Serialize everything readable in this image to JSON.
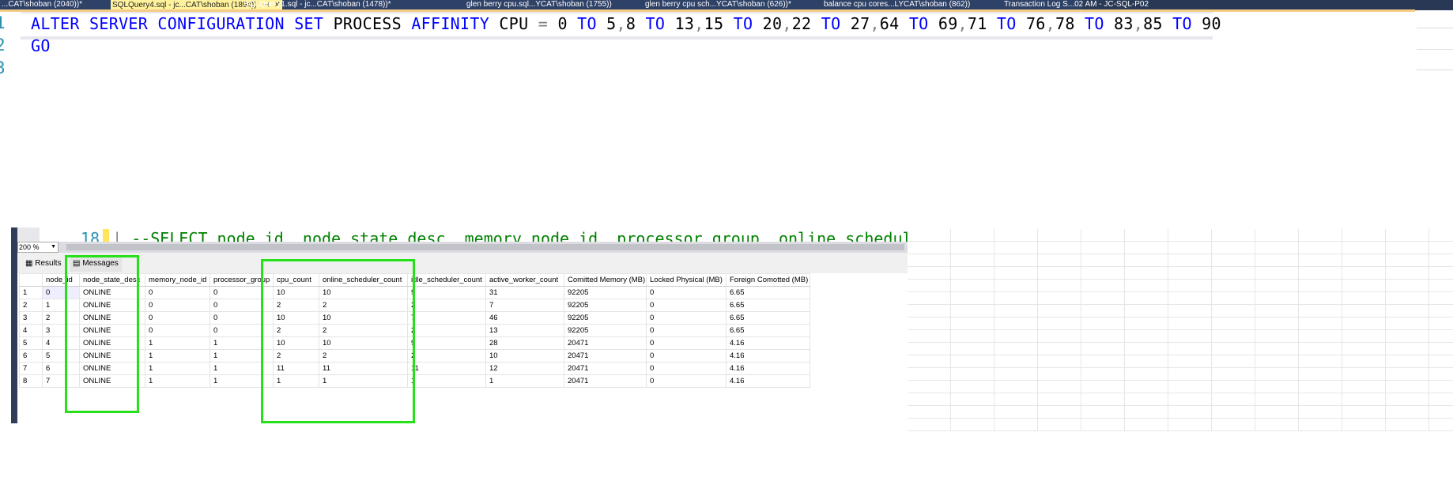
{
  "tabs": [
    {
      "label": "...CAT\\shoban (2040))*",
      "active": false
    },
    {
      "label": "SQLQuery4.sql - jc...CAT\\shoban (1894))",
      "active": true
    },
    {
      "label": "SQLQuery1.sql - jc...CAT\\shoban (1478))*",
      "active": false
    },
    {
      "label": "glen berry cpu.sql...YCAT\\shoban (1755))",
      "active": false
    },
    {
      "label": "glen berry cpu sch...YCAT\\shoban (626))*",
      "active": false
    },
    {
      "label": "balance cpu cores...LYCAT\\shoban (862))",
      "active": false
    },
    {
      "label": "Transaction Log S...02 AM - JC-SQL-P02",
      "active": false
    }
  ],
  "tab_icons": {
    "pin": "⊣",
    "close": "✕"
  },
  "editor": {
    "line_numbers": [
      "1",
      "2",
      "3"
    ],
    "line1_tokens": [
      {
        "t": "ALTER SERVER CONFIGURATION SET",
        "c": "kw"
      },
      {
        "t": " PROCESS ",
        "c": ""
      },
      {
        "t": "AFFINITY",
        "c": "kw"
      },
      {
        "t": " CPU ",
        "c": ""
      },
      {
        "t": "=",
        "c": "op"
      },
      {
        "t": " 0 ",
        "c": ""
      },
      {
        "t": "TO",
        "c": "kw"
      },
      {
        "t": " 5",
        "c": ""
      },
      {
        "t": ",",
        "c": "op"
      },
      {
        "t": "8 ",
        "c": ""
      },
      {
        "t": "TO",
        "c": "kw"
      },
      {
        "t": " 13",
        "c": ""
      },
      {
        "t": ",",
        "c": "op"
      },
      {
        "t": "15 ",
        "c": ""
      },
      {
        "t": "TO",
        "c": "kw"
      },
      {
        "t": " 20",
        "c": ""
      },
      {
        "t": ",",
        "c": "op"
      },
      {
        "t": "22 ",
        "c": ""
      },
      {
        "t": "TO",
        "c": "kw"
      },
      {
        "t": " 27",
        "c": ""
      },
      {
        "t": ",",
        "c": "op"
      },
      {
        "t": "64 ",
        "c": ""
      },
      {
        "t": "TO",
        "c": "kw"
      },
      {
        "t": " 69",
        "c": ""
      },
      {
        "t": ",",
        "c": "op"
      },
      {
        "t": "71 ",
        "c": ""
      },
      {
        "t": "TO",
        "c": "kw"
      },
      {
        "t": " 76",
        "c": ""
      },
      {
        "t": ",",
        "c": "op"
      },
      {
        "t": "78 ",
        "c": ""
      },
      {
        "t": "TO",
        "c": "kw"
      },
      {
        "t": " 83",
        "c": ""
      },
      {
        "t": ",",
        "c": "op"
      },
      {
        "t": "85 ",
        "c": ""
      },
      {
        "t": "TO",
        "c": "kw"
      },
      {
        "t": " 90",
        "c": ""
      }
    ],
    "line2": "GO"
  },
  "lower": {
    "line_number": "18",
    "code": "--SELECT node_id, node_state_desc, memory_node_id, processor_group, online_schedul",
    "zoom": "200 %",
    "results_tab": "Results",
    "messages_tab": "Messages",
    "columns": [
      "",
      "node_id",
      "node_state_desc",
      "memory_node_id",
      "processor_group",
      "cpu_count",
      "online_scheduler_count",
      "idle_scheduler_count",
      "active_worker_count",
      "Comitted Memory (MB)",
      "Locked Physical (MB)",
      "Foreign Comotted (MB)"
    ],
    "rows": [
      [
        "1",
        "0",
        "ONLINE",
        "0",
        "0",
        "10",
        "10",
        "9",
        "31",
        "92205",
        "0",
        "6.65"
      ],
      [
        "2",
        "1",
        "ONLINE",
        "0",
        "0",
        "2",
        "2",
        "2",
        "7",
        "92205",
        "0",
        "6.65"
      ],
      [
        "3",
        "2",
        "ONLINE",
        "0",
        "0",
        "10",
        "10",
        "7",
        "46",
        "92205",
        "0",
        "6.65"
      ],
      [
        "4",
        "3",
        "ONLINE",
        "0",
        "0",
        "2",
        "2",
        "2",
        "13",
        "92205",
        "0",
        "6.65"
      ],
      [
        "5",
        "4",
        "ONLINE",
        "1",
        "1",
        "10",
        "10",
        "9",
        "28",
        "20471",
        "0",
        "4.16"
      ],
      [
        "6",
        "5",
        "ONLINE",
        "1",
        "1",
        "2",
        "2",
        "2",
        "10",
        "20471",
        "0",
        "4.16"
      ],
      [
        "7",
        "6",
        "ONLINE",
        "1",
        "1",
        "11",
        "11",
        "11",
        "12",
        "20471",
        "0",
        "4.16"
      ],
      [
        "8",
        "7",
        "ONLINE",
        "1",
        "1",
        "1",
        "1",
        "1",
        "1",
        "20471",
        "0",
        "4.16"
      ]
    ]
  },
  "colors": {
    "highlight": "#26e01a",
    "keyword": "#0000ff",
    "tabbar": "#2e4167"
  }
}
